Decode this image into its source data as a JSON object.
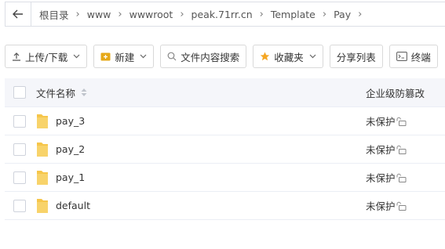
{
  "breadcrumb": {
    "items": [
      "根目录",
      "www",
      "wwwroot",
      "peak.71rr.cn",
      "Template",
      "Pay"
    ]
  },
  "toolbar": {
    "upload_label": "上传/下载",
    "new_label": "新建",
    "search_label": "文件内容搜索",
    "favorites_label": "收藏夹",
    "share_list_label": "分享列表",
    "terminal_label": "终端"
  },
  "table": {
    "headers": {
      "name": "文件名称",
      "protection": "企业级防篡改"
    },
    "rows": [
      {
        "name": "pay_3",
        "protection": "未保护"
      },
      {
        "name": "pay_2",
        "protection": "未保护"
      },
      {
        "name": "pay_1",
        "protection": "未保护"
      },
      {
        "name": "default",
        "protection": "未保护"
      }
    ]
  },
  "colors": {
    "folder": "#f6c64a",
    "star": "#f5a623",
    "new_icon": "#e6a817",
    "border": "#dcdfe6",
    "header_bg": "#f5f6fa"
  }
}
